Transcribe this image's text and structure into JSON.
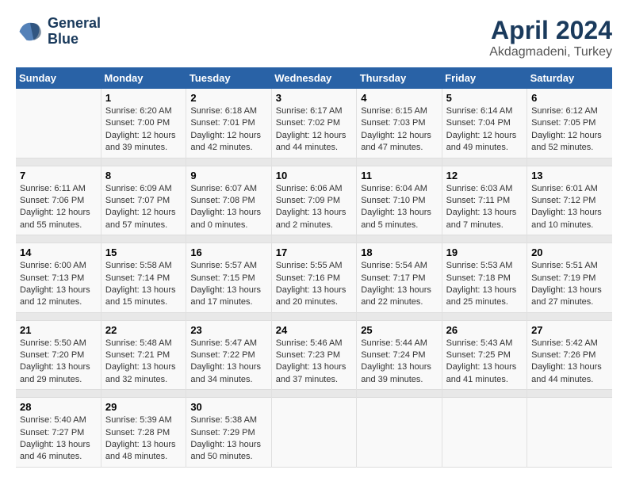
{
  "logo": {
    "line1": "General",
    "line2": "Blue"
  },
  "title": "April 2024",
  "subtitle": "Akdagmadeni, Turkey",
  "days_of_week": [
    "Sunday",
    "Monday",
    "Tuesday",
    "Wednesday",
    "Thursday",
    "Friday",
    "Saturday"
  ],
  "weeks": [
    [
      {
        "num": "",
        "sunrise": "",
        "sunset": "",
        "daylight": ""
      },
      {
        "num": "1",
        "sunrise": "Sunrise: 6:20 AM",
        "sunset": "Sunset: 7:00 PM",
        "daylight": "Daylight: 12 hours and 39 minutes."
      },
      {
        "num": "2",
        "sunrise": "Sunrise: 6:18 AM",
        "sunset": "Sunset: 7:01 PM",
        "daylight": "Daylight: 12 hours and 42 minutes."
      },
      {
        "num": "3",
        "sunrise": "Sunrise: 6:17 AM",
        "sunset": "Sunset: 7:02 PM",
        "daylight": "Daylight: 12 hours and 44 minutes."
      },
      {
        "num": "4",
        "sunrise": "Sunrise: 6:15 AM",
        "sunset": "Sunset: 7:03 PM",
        "daylight": "Daylight: 12 hours and 47 minutes."
      },
      {
        "num": "5",
        "sunrise": "Sunrise: 6:14 AM",
        "sunset": "Sunset: 7:04 PM",
        "daylight": "Daylight: 12 hours and 49 minutes."
      },
      {
        "num": "6",
        "sunrise": "Sunrise: 6:12 AM",
        "sunset": "Sunset: 7:05 PM",
        "daylight": "Daylight: 12 hours and 52 minutes."
      }
    ],
    [
      {
        "num": "7",
        "sunrise": "Sunrise: 6:11 AM",
        "sunset": "Sunset: 7:06 PM",
        "daylight": "Daylight: 12 hours and 55 minutes."
      },
      {
        "num": "8",
        "sunrise": "Sunrise: 6:09 AM",
        "sunset": "Sunset: 7:07 PM",
        "daylight": "Daylight: 12 hours and 57 minutes."
      },
      {
        "num": "9",
        "sunrise": "Sunrise: 6:07 AM",
        "sunset": "Sunset: 7:08 PM",
        "daylight": "Daylight: 13 hours and 0 minutes."
      },
      {
        "num": "10",
        "sunrise": "Sunrise: 6:06 AM",
        "sunset": "Sunset: 7:09 PM",
        "daylight": "Daylight: 13 hours and 2 minutes."
      },
      {
        "num": "11",
        "sunrise": "Sunrise: 6:04 AM",
        "sunset": "Sunset: 7:10 PM",
        "daylight": "Daylight: 13 hours and 5 minutes."
      },
      {
        "num": "12",
        "sunrise": "Sunrise: 6:03 AM",
        "sunset": "Sunset: 7:11 PM",
        "daylight": "Daylight: 13 hours and 7 minutes."
      },
      {
        "num": "13",
        "sunrise": "Sunrise: 6:01 AM",
        "sunset": "Sunset: 7:12 PM",
        "daylight": "Daylight: 13 hours and 10 minutes."
      }
    ],
    [
      {
        "num": "14",
        "sunrise": "Sunrise: 6:00 AM",
        "sunset": "Sunset: 7:13 PM",
        "daylight": "Daylight: 13 hours and 12 minutes."
      },
      {
        "num": "15",
        "sunrise": "Sunrise: 5:58 AM",
        "sunset": "Sunset: 7:14 PM",
        "daylight": "Daylight: 13 hours and 15 minutes."
      },
      {
        "num": "16",
        "sunrise": "Sunrise: 5:57 AM",
        "sunset": "Sunset: 7:15 PM",
        "daylight": "Daylight: 13 hours and 17 minutes."
      },
      {
        "num": "17",
        "sunrise": "Sunrise: 5:55 AM",
        "sunset": "Sunset: 7:16 PM",
        "daylight": "Daylight: 13 hours and 20 minutes."
      },
      {
        "num": "18",
        "sunrise": "Sunrise: 5:54 AM",
        "sunset": "Sunset: 7:17 PM",
        "daylight": "Daylight: 13 hours and 22 minutes."
      },
      {
        "num": "19",
        "sunrise": "Sunrise: 5:53 AM",
        "sunset": "Sunset: 7:18 PM",
        "daylight": "Daylight: 13 hours and 25 minutes."
      },
      {
        "num": "20",
        "sunrise": "Sunrise: 5:51 AM",
        "sunset": "Sunset: 7:19 PM",
        "daylight": "Daylight: 13 hours and 27 minutes."
      }
    ],
    [
      {
        "num": "21",
        "sunrise": "Sunrise: 5:50 AM",
        "sunset": "Sunset: 7:20 PM",
        "daylight": "Daylight: 13 hours and 29 minutes."
      },
      {
        "num": "22",
        "sunrise": "Sunrise: 5:48 AM",
        "sunset": "Sunset: 7:21 PM",
        "daylight": "Daylight: 13 hours and 32 minutes."
      },
      {
        "num": "23",
        "sunrise": "Sunrise: 5:47 AM",
        "sunset": "Sunset: 7:22 PM",
        "daylight": "Daylight: 13 hours and 34 minutes."
      },
      {
        "num": "24",
        "sunrise": "Sunrise: 5:46 AM",
        "sunset": "Sunset: 7:23 PM",
        "daylight": "Daylight: 13 hours and 37 minutes."
      },
      {
        "num": "25",
        "sunrise": "Sunrise: 5:44 AM",
        "sunset": "Sunset: 7:24 PM",
        "daylight": "Daylight: 13 hours and 39 minutes."
      },
      {
        "num": "26",
        "sunrise": "Sunrise: 5:43 AM",
        "sunset": "Sunset: 7:25 PM",
        "daylight": "Daylight: 13 hours and 41 minutes."
      },
      {
        "num": "27",
        "sunrise": "Sunrise: 5:42 AM",
        "sunset": "Sunset: 7:26 PM",
        "daylight": "Daylight: 13 hours and 44 minutes."
      }
    ],
    [
      {
        "num": "28",
        "sunrise": "Sunrise: 5:40 AM",
        "sunset": "Sunset: 7:27 PM",
        "daylight": "Daylight: 13 hours and 46 minutes."
      },
      {
        "num": "29",
        "sunrise": "Sunrise: 5:39 AM",
        "sunset": "Sunset: 7:28 PM",
        "daylight": "Daylight: 13 hours and 48 minutes."
      },
      {
        "num": "30",
        "sunrise": "Sunrise: 5:38 AM",
        "sunset": "Sunset: 7:29 PM",
        "daylight": "Daylight: 13 hours and 50 minutes."
      },
      {
        "num": "",
        "sunrise": "",
        "sunset": "",
        "daylight": ""
      },
      {
        "num": "",
        "sunrise": "",
        "sunset": "",
        "daylight": ""
      },
      {
        "num": "",
        "sunrise": "",
        "sunset": "",
        "daylight": ""
      },
      {
        "num": "",
        "sunrise": "",
        "sunset": "",
        "daylight": ""
      }
    ]
  ]
}
